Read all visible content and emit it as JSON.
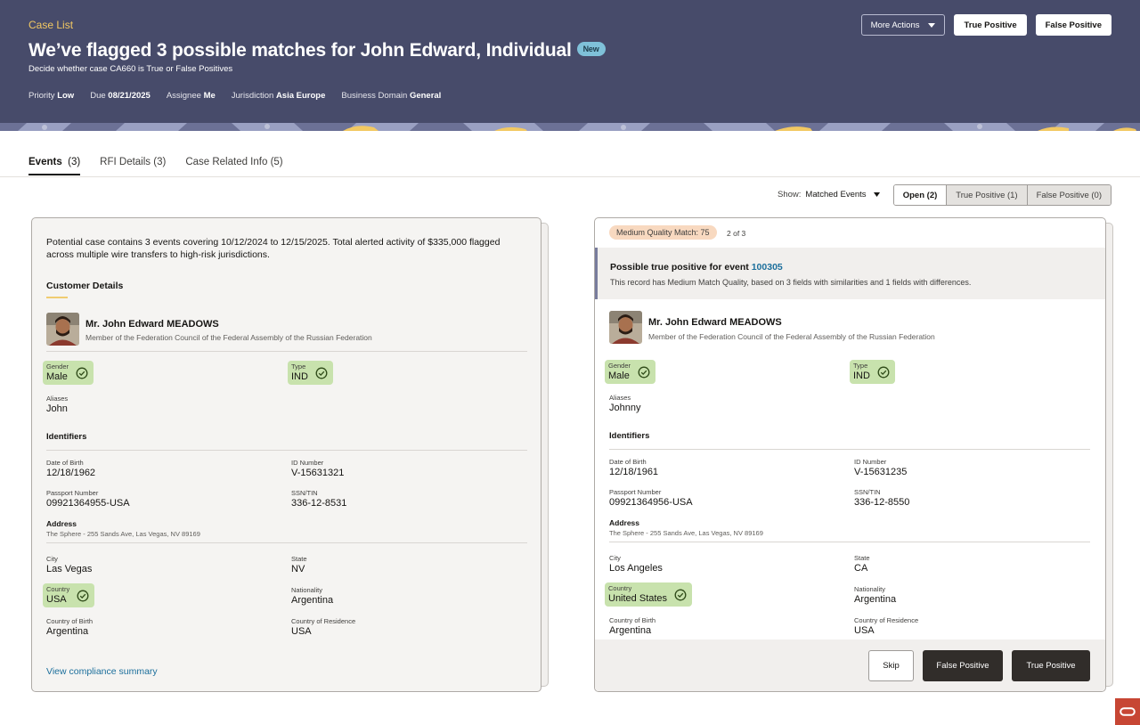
{
  "header": {
    "breadcrumb": "Case List",
    "title": "We’ve flagged 3 possible matches for John Edward, Individual",
    "badge": "New",
    "subtitle": "Decide whether case CA660 is True or False Positives",
    "meta": [
      {
        "label": "Priority",
        "value": "Low"
      },
      {
        "label": "Due",
        "value": "08/21/2025"
      },
      {
        "label": "Assignee",
        "value": "Me"
      },
      {
        "label": "Jurisdiction",
        "value": "Asia Europe"
      },
      {
        "label": "Business Domain",
        "value": "General"
      }
    ],
    "more_actions": "More Actions",
    "true_positive": "True Positive",
    "false_positive": "False Positive"
  },
  "tabs": [
    {
      "label": "Events",
      "count": "(3)"
    },
    {
      "label": "RFI Details",
      "count": "(3)"
    },
    {
      "label": "Case Related Info",
      "count": "(5)"
    }
  ],
  "filter": {
    "show_label": "Show:",
    "show_value": "Matched Events",
    "segments": [
      "Open (2)",
      "True Positive (1)",
      "False Positive (0)"
    ]
  },
  "left": {
    "intro": "Potential case contains 3 events covering 10/12/2024 to 12/15/2025. Total alerted activity of $335,000 flagged across multiple wire transfers to high-risk jurisdictions.",
    "section": "Customer Details",
    "name": "Mr. John Edward MEADOWS",
    "role": "Member of the Federation Council of the Federal Assembly of the Russian Federation",
    "gender": {
      "label": "Gender",
      "value": "Male"
    },
    "type": {
      "label": "Type",
      "value": "IND"
    },
    "aliases": {
      "label": "Aliases",
      "value": "John"
    },
    "identifiers": "Identifiers",
    "dob": {
      "label": "Date of Birth",
      "value": "12/18/1962"
    },
    "id_number": {
      "label": "ID Number",
      "value": "V-15631321"
    },
    "passport": {
      "label": "Passport Number",
      "value": "09921364955-USA"
    },
    "ssn": {
      "label": "SSN/TIN",
      "value": "336-12-8531"
    },
    "address": {
      "label": "Address",
      "value": "The Sphere - 255 Sands Ave, Las Vegas, NV 89169"
    },
    "city": {
      "label": "City",
      "value": "Las Vegas"
    },
    "state": {
      "label": "State",
      "value": "NV"
    },
    "country": {
      "label": "Country",
      "value": "USA"
    },
    "nationality": {
      "label": "Nationality",
      "value": "Argentina"
    },
    "cob": {
      "label": "Country of Birth",
      "value": "Argentina"
    },
    "cor": {
      "label": "Country of Residence",
      "value": "USA"
    },
    "link": "View compliance summary"
  },
  "right": {
    "quality": "Medium Quality Match: 75",
    "position": "2 of 3",
    "banner_title": "Possible true positive for event",
    "event_id": "100305",
    "banner_desc": "This record has Medium Match Quality, based on 3 fields with similarities and 1 fields with differences.",
    "name": "Mr. John Edward MEADOWS",
    "role": "Member of the Federation Council of the Federal Assembly of the Russian Federation",
    "gender": {
      "label": "Gender",
      "value": "Male"
    },
    "type": {
      "label": "Type",
      "value": "IND"
    },
    "aliases": {
      "label": "Aliases",
      "value": "Johnny"
    },
    "identifiers": "Identifiers",
    "dob": {
      "label": "Date of Birth",
      "value": "12/18/1961"
    },
    "id_number": {
      "label": "ID Number",
      "value": "V-15631235"
    },
    "passport": {
      "label": "Passport Number",
      "value": "09921364956-USA"
    },
    "ssn": {
      "label": "SSN/TIN",
      "value": "336-12-8550"
    },
    "address": {
      "label": "Address",
      "value": "The Sphere - 255 Sands Ave, Las Vegas, NV 89169"
    },
    "city": {
      "label": "City",
      "value": "Los Angeles"
    },
    "state": {
      "label": "State",
      "value": "CA"
    },
    "country": {
      "label": "Country",
      "value": "United States"
    },
    "nationality": {
      "label": "Nationality",
      "value": "Argentina"
    },
    "cob": {
      "label": "Country of Birth",
      "value": "Argentina"
    },
    "cor": {
      "label": "Country of Residence",
      "value": "USA"
    },
    "skip": "Skip",
    "false_positive": "False Positive",
    "true_positive": "True Positive"
  },
  "colors": {
    "header_bg": "#474b6a",
    "accent_gold": "#f2c862",
    "match_green": "#c8e2ad",
    "link_blue": "#1c6f9c",
    "oracle_red": "#c74634"
  }
}
